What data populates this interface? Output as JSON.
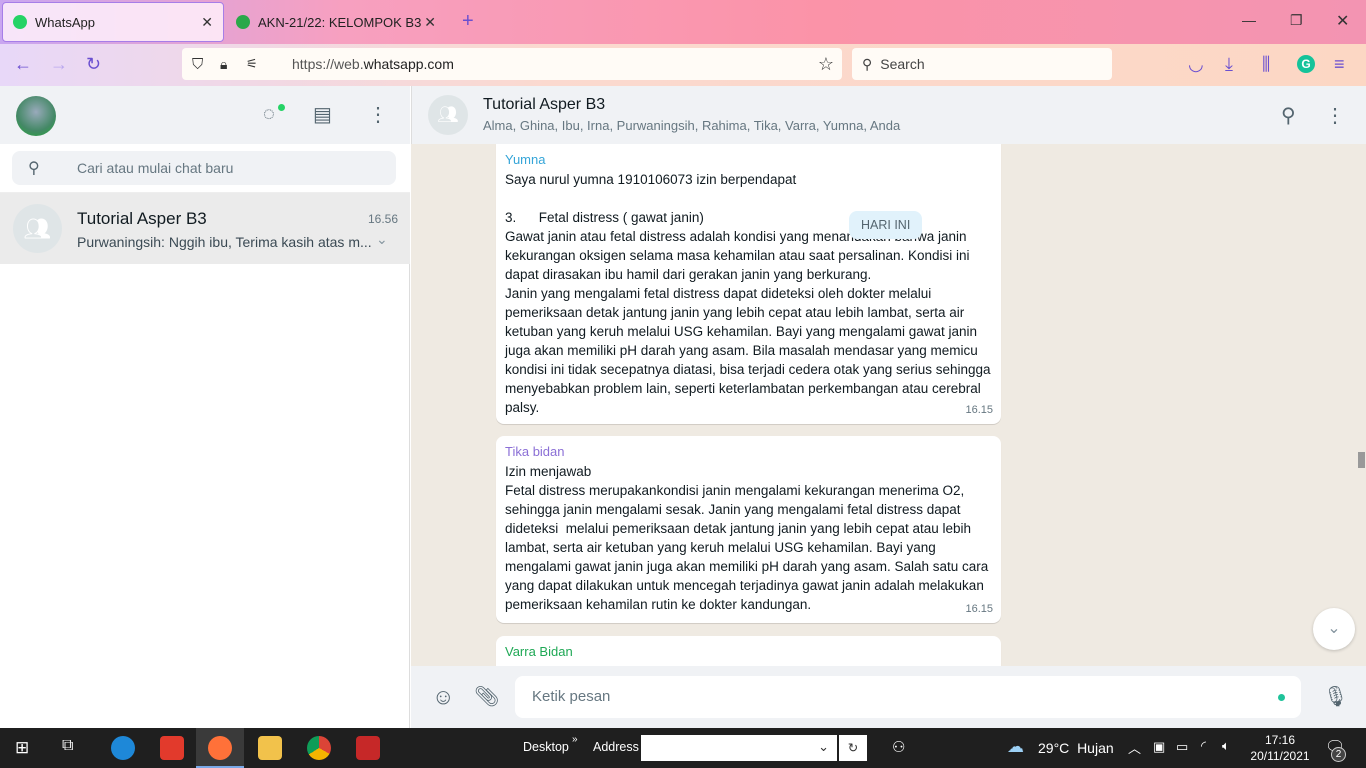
{
  "browser": {
    "tabs": [
      {
        "label": "WhatsApp",
        "active": true
      },
      {
        "label": "AKN-21/22: KELOMPOK B3",
        "active": false
      }
    ],
    "url_prefix": "https://web.",
    "url_domain": "whatsapp.com",
    "search_placeholder": "Search"
  },
  "sidebar": {
    "search_placeholder": "Cari atau mulai chat baru",
    "chats": [
      {
        "name": "Tutorial Asper B3",
        "time": "16.56",
        "preview": "Purwaningsih: Nggih ibu, Terima kasih atas m..."
      }
    ]
  },
  "conversation": {
    "title": "Tutorial Asper B3",
    "members": "Alma, Ghina, Ibu, Irna, Purwaningsih, Rahima, Tika, Varra, Yumna, Anda",
    "date_badge": "HARI INI",
    "messages": [
      {
        "sender": "Yumna",
        "sender_color": "#35a5d8",
        "text": "Saya nurul yumna 1910106073 izin berpendapat\n\n3.      Fetal distress ( gawat janin)\nGawat janin atau fetal distress adalah kondisi yang menandakan bahwa janin kekurangan oksigen selama masa kehamilan atau saat persalinan. Kondisi ini dapat dirasakan ibu hamil dari gerakan janin yang berkurang.\nJanin yang mengalami fetal distress dapat dideteksi oleh dokter melalui pemeriksaan detak jantung janin yang lebih cepat atau lebih lambat, serta air ketuban yang keruh melalui USG kehamilan. Bayi yang mengalami gawat janin juga akan memiliki pH darah yang asam. Bila masalah mendasar yang memicu kondisi ini tidak secepatnya diatasi, bisa terjadi cedera otak yang serius sehingga menyebabkan problem lain, seperti keterlambatan perkembangan atau cerebral palsy.",
        "time": "16.15"
      },
      {
        "sender": "Tika bidan",
        "sender_color": "#8b6fd6",
        "text": "Izin menjawab\nFetal distress merupakankondisi janin mengalami kekurangan menerima O2, sehingga janin mengalami sesak. Janin yang mengalami fetal distress dapat dideteksi  melalui pemeriksaan detak jantung janin yang lebih cepat atau lebih lambat, serta air ketuban yang keruh melalui USG kehamilan. Bayi yang mengalami gawat janin juga akan memiliki pH darah yang asam. Salah satu cara yang dapat dilakukan untuk mencegah terjadinya gawat janin adalah melakukan pemeriksaan kehamilan rutin ke dokter kandungan.",
        "time": "16.15"
      },
      {
        "sender": "Varra Bidan",
        "sender_color": "#1fa855",
        "text": "",
        "time": ""
      }
    ],
    "input_placeholder": "Ketik pesan"
  },
  "taskbar": {
    "desktop_label": "Desktop",
    "address_label": "Address",
    "weather_temp": "29°C",
    "weather_text": "Hujan",
    "time": "17:16",
    "date": "20/11/2021",
    "notifications": "2"
  }
}
